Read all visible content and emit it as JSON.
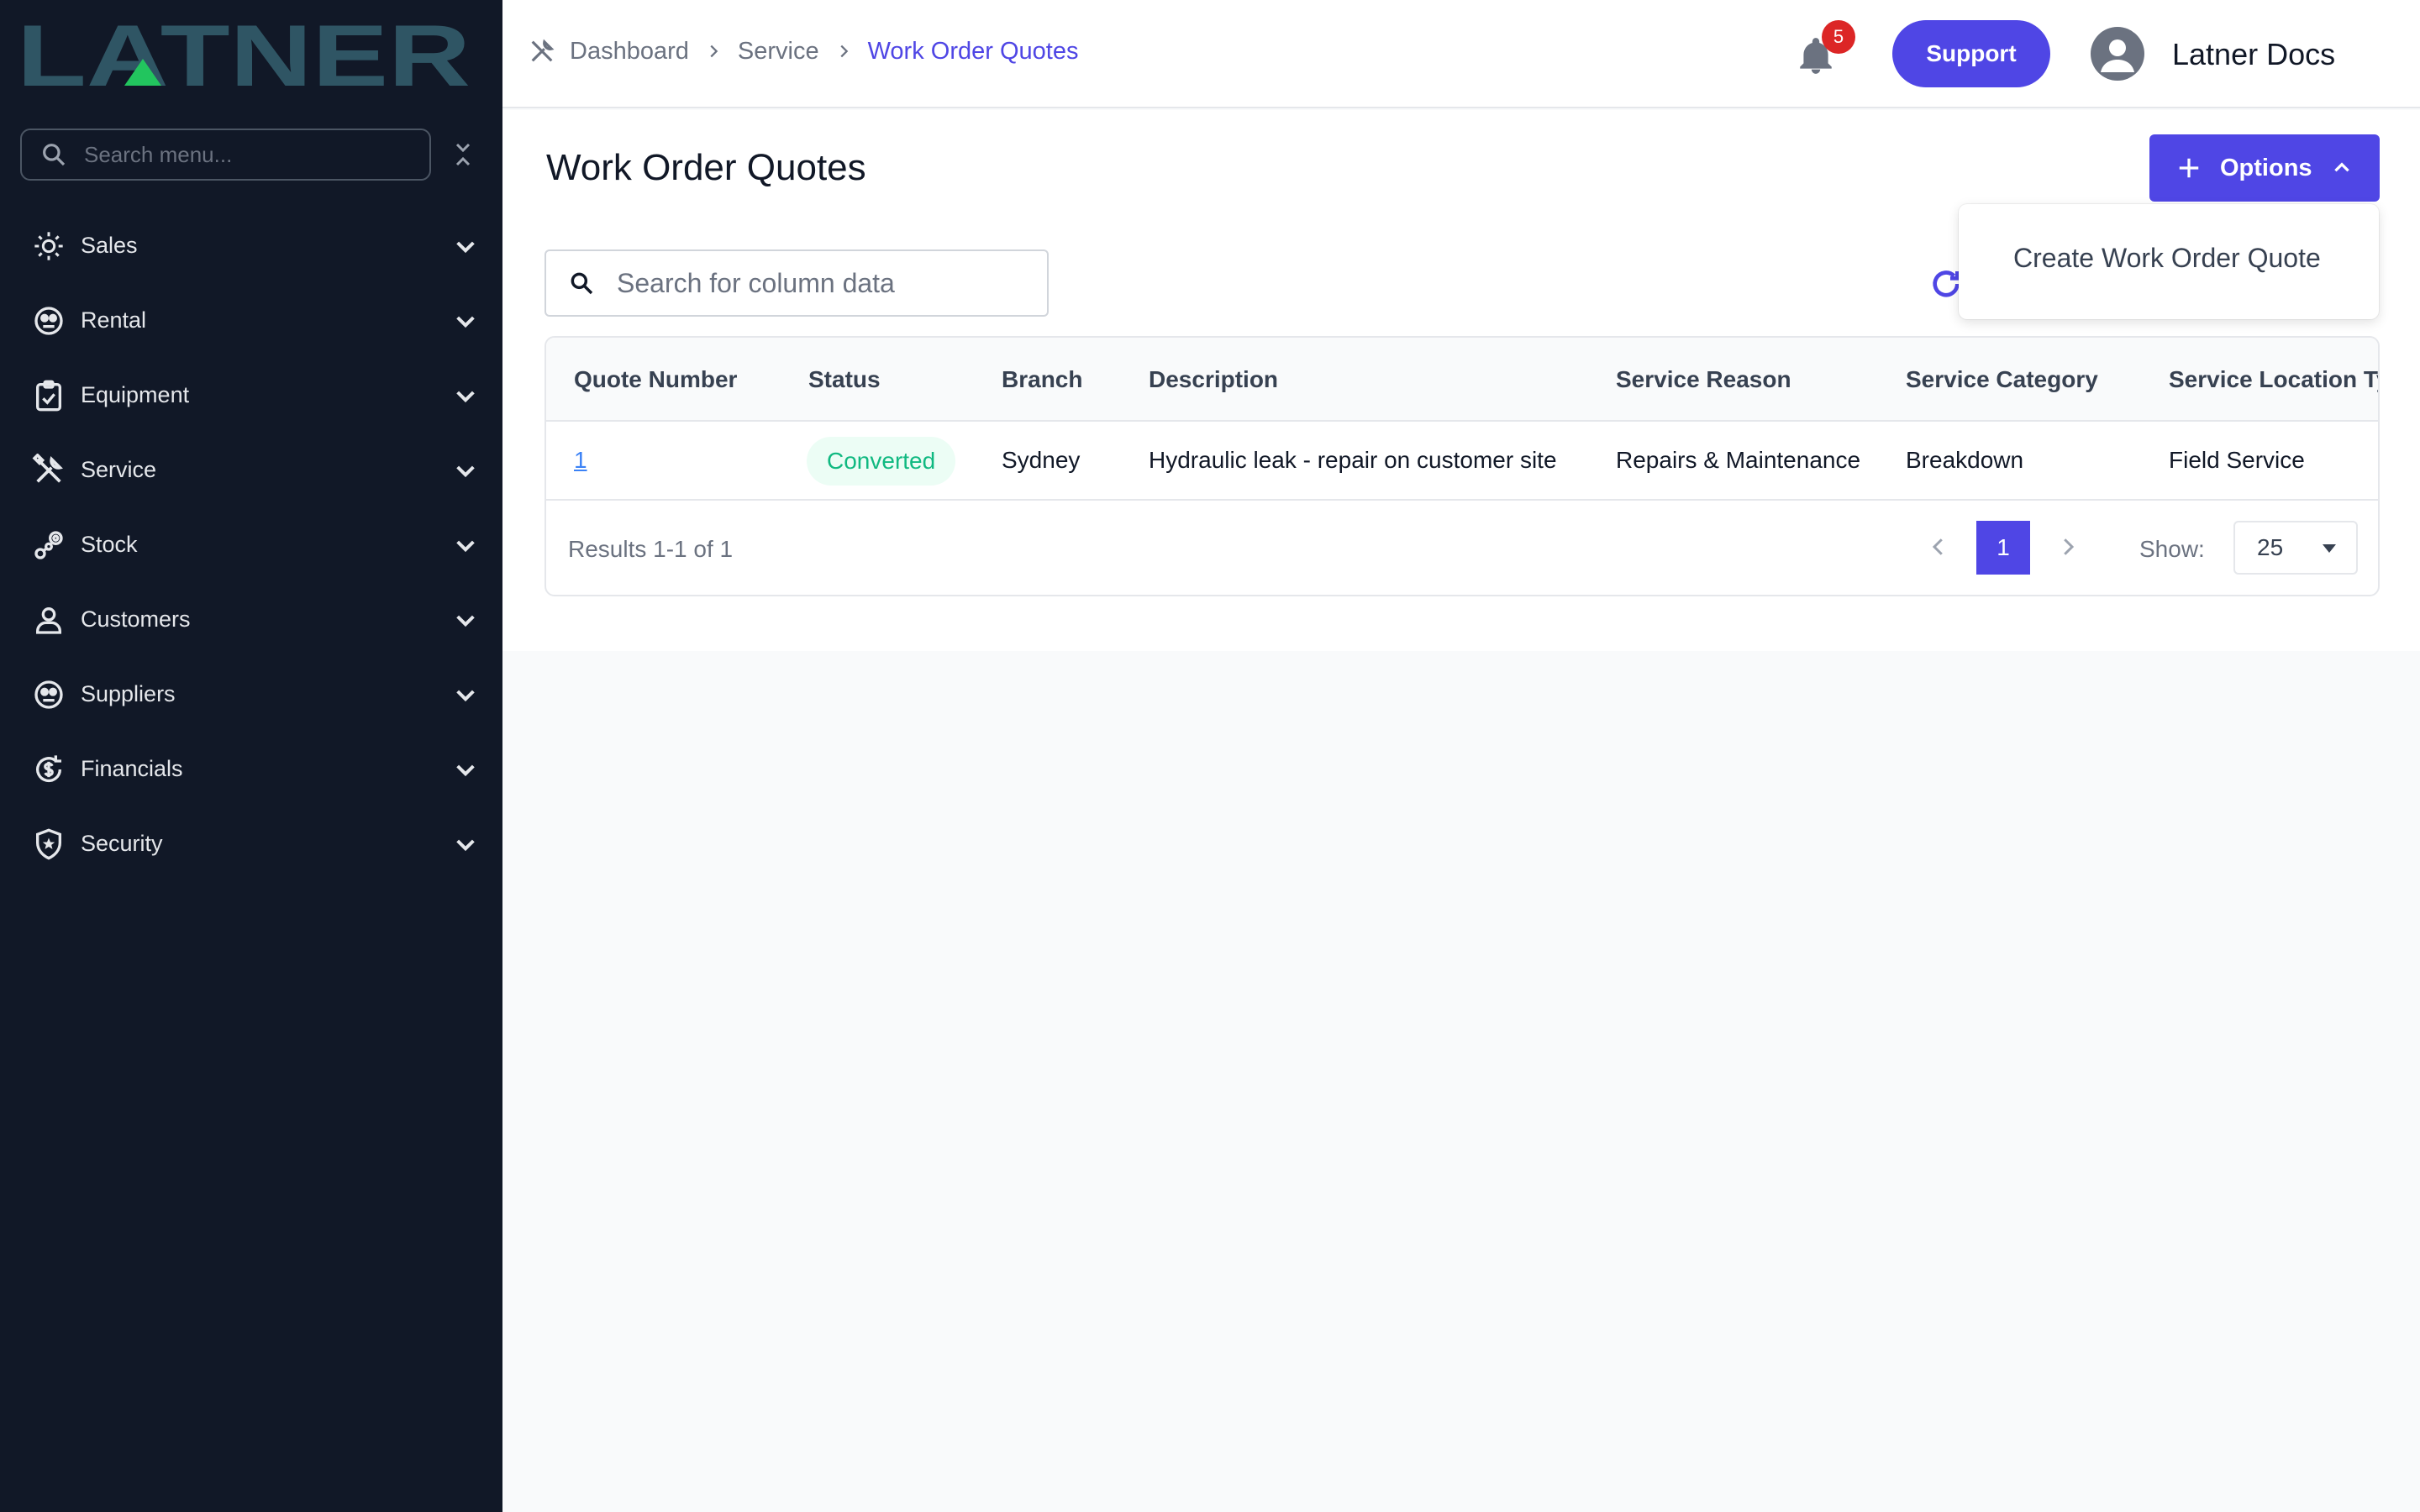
{
  "app": {
    "logo_text": "LATNER"
  },
  "sidebar": {
    "search_placeholder": "Search menu...",
    "items": [
      {
        "label": "Sales",
        "icon": "sales-icon"
      },
      {
        "label": "Rental",
        "icon": "rental-icon"
      },
      {
        "label": "Equipment",
        "icon": "equipment-icon"
      },
      {
        "label": "Service",
        "icon": "service-icon"
      },
      {
        "label": "Stock",
        "icon": "stock-icon"
      },
      {
        "label": "Customers",
        "icon": "customers-icon"
      },
      {
        "label": "Suppliers",
        "icon": "suppliers-icon"
      },
      {
        "label": "Financials",
        "icon": "financials-icon"
      },
      {
        "label": "Security",
        "icon": "security-icon"
      }
    ]
  },
  "header": {
    "breadcrumb": [
      "Dashboard",
      "Service",
      "Work Order Quotes"
    ],
    "notification_count": "5",
    "support_label": "Support",
    "user_name": "Latner Docs"
  },
  "page": {
    "title": "Work Order Quotes",
    "options_label": "Options",
    "options_menu": [
      "Create Work Order Quote"
    ],
    "column_search_placeholder": "Search for column data"
  },
  "table": {
    "columns": [
      "Quote Number",
      "Status",
      "Branch",
      "Description",
      "Service Reason",
      "Service Category",
      "Service Location Ty"
    ],
    "rows": [
      {
        "quote_number": "1",
        "status": "Converted",
        "branch": "Sydney",
        "description": "Hydraulic leak - repair on customer site",
        "service_reason": "Repairs & Maintenance",
        "service_category": "Breakdown",
        "service_location": "Field Service"
      }
    ],
    "results_text": "Results 1-1 of 1",
    "current_page": "1",
    "show_label": "Show:",
    "page_size": "25"
  },
  "colors": {
    "sidebar_bg": "#111827",
    "accent": "#4f46e5",
    "logo": "#2f5564",
    "logo_triangle": "#22c55e",
    "status_green": "#10b981",
    "badge_red": "#dc2626"
  }
}
